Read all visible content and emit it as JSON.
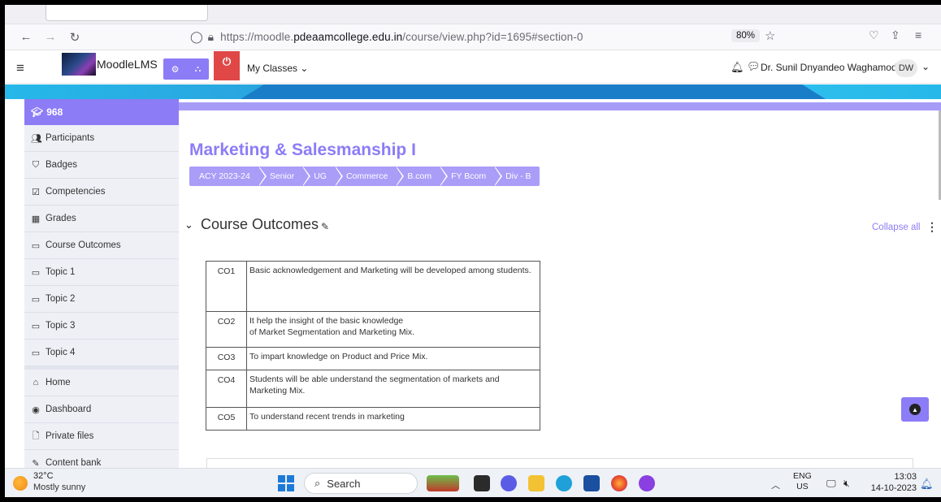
{
  "browser": {
    "url_prefix": "https://moodle.",
    "url_domain": "pdeaamcollege.edu.in",
    "url_path": "/course/view.php?id=1695#section-0",
    "zoom": "80%"
  },
  "header": {
    "brand": "MoodleLMS",
    "my_classes": "My Classes ⌄",
    "user_name": "Dr. Sunil Dnyandeo Waghamode",
    "user_initials": "DW"
  },
  "sidebar": {
    "course": "968",
    "items": [
      {
        "label": "Participants",
        "icon": "users-icon"
      },
      {
        "label": "Badges",
        "icon": "shield-icon"
      },
      {
        "label": "Competencies",
        "icon": "checkbox-icon"
      },
      {
        "label": "Grades",
        "icon": "table-icon"
      },
      {
        "label": "Course Outcomes",
        "icon": "folder-icon"
      },
      {
        "label": "Topic 1",
        "icon": "folder-icon"
      },
      {
        "label": "Topic 2",
        "icon": "folder-icon"
      },
      {
        "label": "Topic 3",
        "icon": "folder-icon"
      },
      {
        "label": "Topic 4",
        "icon": "folder-icon"
      },
      {
        "label": "Home",
        "icon": "home-icon"
      },
      {
        "label": "Dashboard",
        "icon": "dashboard-icon"
      },
      {
        "label": "Private files",
        "icon": "file-icon"
      },
      {
        "label": "Content bank",
        "icon": "brush-icon"
      }
    ]
  },
  "course": {
    "title": "Marketing & Salesmanship I",
    "breadcrumbs": [
      "ACY 2023-24",
      "Senior",
      "UG",
      "Commerce",
      "B.com",
      "FY Bcom",
      "Div - B"
    ]
  },
  "section": {
    "title": "Course Outcomes",
    "collapse_all": "Collapse all"
  },
  "outcomes": [
    {
      "code": "CO1",
      "text": "Basic acknowledgement and Marketing will be developed among students."
    },
    {
      "code": "CO2",
      "text": "It help the insight of the basic knowledge\nof Market Segmentation and Marketing Mix."
    },
    {
      "code": "CO3",
      "text": "To impart knowledge on Product and Price Mix."
    },
    {
      "code": "CO4",
      "text": "Students will be able  understand the segmentation of markets and Marketing Mix."
    },
    {
      "code": "CO5",
      "text": "To understand recent trends in marketing"
    }
  ],
  "taskbar": {
    "temperature": "32°C",
    "weather": "Mostly sunny",
    "search": "Search",
    "lang_top": "ENG",
    "lang_bottom": "US",
    "time": "13:03",
    "date": "14-10-2023"
  },
  "colors": {
    "accent": "#8c7cf6",
    "breadcrumb": "#a99df8"
  }
}
